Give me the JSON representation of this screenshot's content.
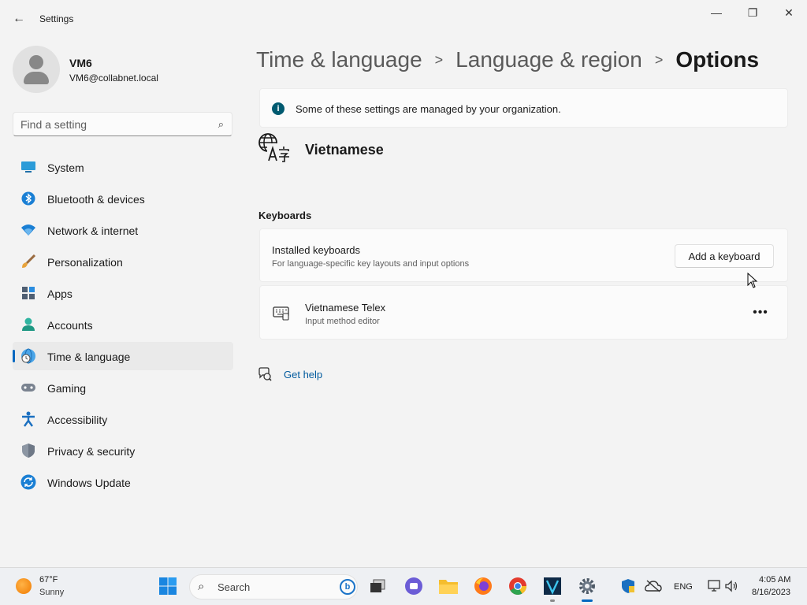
{
  "window": {
    "title": "Settings",
    "back_label": "←",
    "min_label": "—",
    "max_label": "❐",
    "close_label": "✕"
  },
  "user": {
    "name": "VM6",
    "email": "VM6@collabnet.local"
  },
  "search": {
    "placeholder": "Find a setting"
  },
  "sidebar": {
    "items": [
      {
        "label": "System",
        "icon": "system-icon"
      },
      {
        "label": "Bluetooth & devices",
        "icon": "bluetooth-icon"
      },
      {
        "label": "Network & internet",
        "icon": "wifi-icon"
      },
      {
        "label": "Personalization",
        "icon": "brush-icon"
      },
      {
        "label": "Apps",
        "icon": "apps-icon"
      },
      {
        "label": "Accounts",
        "icon": "accounts-icon"
      },
      {
        "label": "Time & language",
        "icon": "time-language-icon",
        "active": true
      },
      {
        "label": "Gaming",
        "icon": "gamepad-icon"
      },
      {
        "label": "Accessibility",
        "icon": "accessibility-icon"
      },
      {
        "label": "Privacy & security",
        "icon": "shield-icon"
      },
      {
        "label": "Windows Update",
        "icon": "update-icon"
      }
    ]
  },
  "breadcrumb": {
    "items": [
      "Time & language",
      "Language & region",
      "Options"
    ]
  },
  "notice": {
    "text": "Some of these settings are managed by your organization.",
    "icon_label": "i"
  },
  "language": {
    "name": "Vietnamese"
  },
  "keyboards": {
    "section_title": "Keyboards",
    "installed": {
      "title": "Installed keyboards",
      "subtitle": "For language-specific key layouts and input options",
      "button": "Add a keyboard"
    },
    "items": [
      {
        "title": "Vietnamese Telex",
        "subtitle": "Input method editor",
        "more": "•••"
      }
    ]
  },
  "help": {
    "label": "Get help"
  },
  "taskbar": {
    "weather": {
      "temp": "67°F",
      "condition": "Sunny"
    },
    "search_label": "Search",
    "bing_label": "b",
    "tray": {
      "lang": "ENG",
      "time": "4:05 AM",
      "date": "8/16/2023"
    }
  },
  "colors": {
    "accent": "#0067c0",
    "link": "#005a9e",
    "info": "#005a70"
  }
}
